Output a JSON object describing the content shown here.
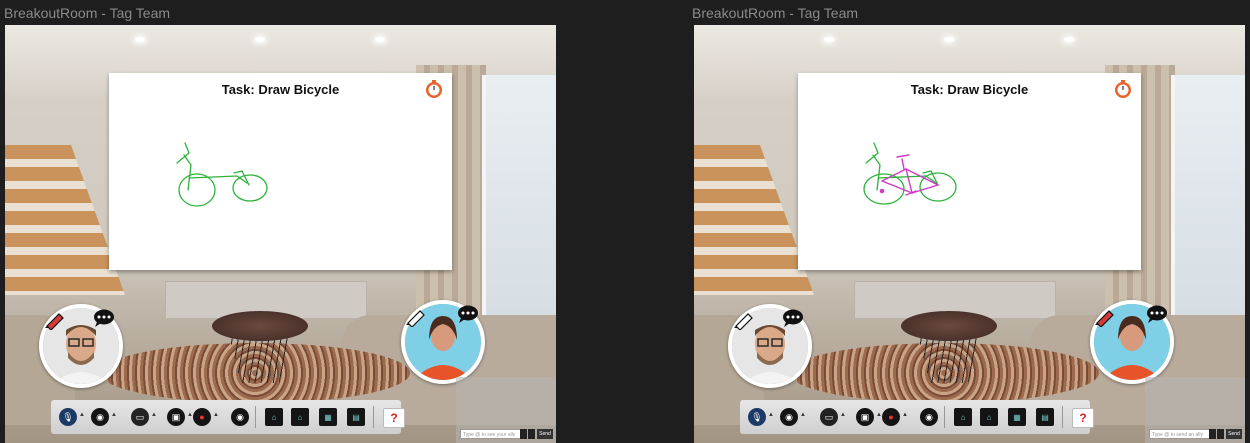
{
  "panels": [
    {
      "window_title": "BreakoutRoom - Tag Team",
      "whiteboard": {
        "task_title": "Task: Draw Bicycle"
      },
      "chat": {
        "placeholder": "Type @ to see your ally",
        "send_label": "Send"
      }
    },
    {
      "window_title": "BreakoutRoom - Tag Team",
      "whiteboard": {
        "task_title": "Task: Draw Bicycle"
      },
      "chat": {
        "placeholder": "Type @ to send an ally",
        "send_label": "Send"
      }
    }
  ],
  "toolbar": {
    "buttons": [
      "microphone-icon",
      "globe-icon",
      "camera-icon",
      "screen-share-icon",
      "record-icon",
      "eye-icon",
      "map-icon",
      "home-icon",
      "grid-icon",
      "document-icon"
    ],
    "help_label": "?"
  },
  "participants": [
    "man-with-glasses",
    "woman-in-orange"
  ],
  "colors": {
    "stroke_user1": "#2db33b",
    "stroke_user2": "#d23ac6",
    "help": "#d22222",
    "background": "#1e1e1e"
  }
}
